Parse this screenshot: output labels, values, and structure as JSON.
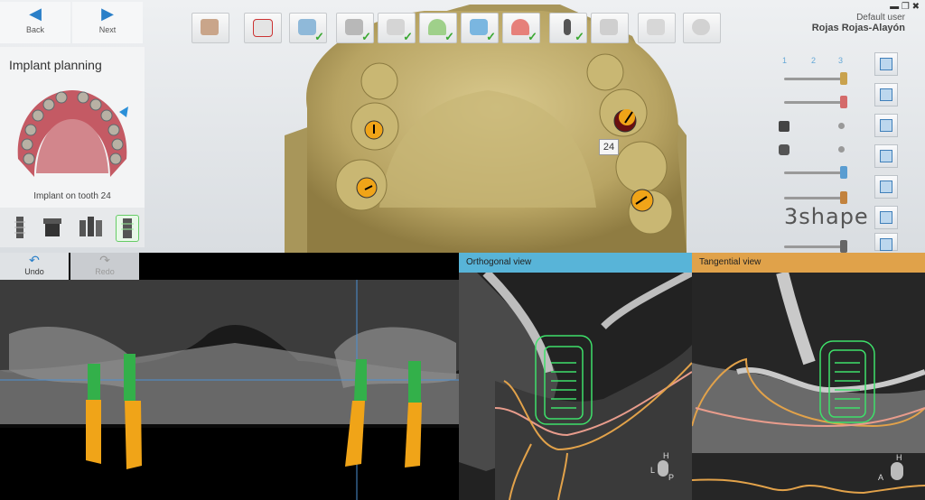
{
  "nav": {
    "back": "Back",
    "next": "Next"
  },
  "user": {
    "role": "Default user",
    "name": "Rojas Rojas-Alayón"
  },
  "toolbar": {
    "steps": [
      "patient",
      "order",
      "scan",
      "cut",
      "model",
      "gingiva",
      "margin",
      "denture",
      "implant",
      "abutment",
      "crown",
      "export"
    ]
  },
  "left_panel": {
    "title": "Implant planning",
    "status": "Implant on tooth 24"
  },
  "tooth_label": "24",
  "slider_labels": [
    "1",
    "2",
    "3"
  ],
  "undo": {
    "undo": "Undo",
    "redo": "Redo"
  },
  "views": {
    "orthogonal": "Orthogonal view",
    "tangential": "Tangential view"
  },
  "logo": "3shape",
  "orientation": {
    "ortho": [
      "H",
      "L",
      "P"
    ],
    "tang": [
      "H",
      "A"
    ]
  },
  "colors": {
    "accent": "#2a7fc8",
    "ortho_header": "#58b4d8",
    "tang_header": "#e0a24a",
    "implant_green": "#33b04a",
    "implant_orange": "#f0a418",
    "check": "#3aa832"
  }
}
